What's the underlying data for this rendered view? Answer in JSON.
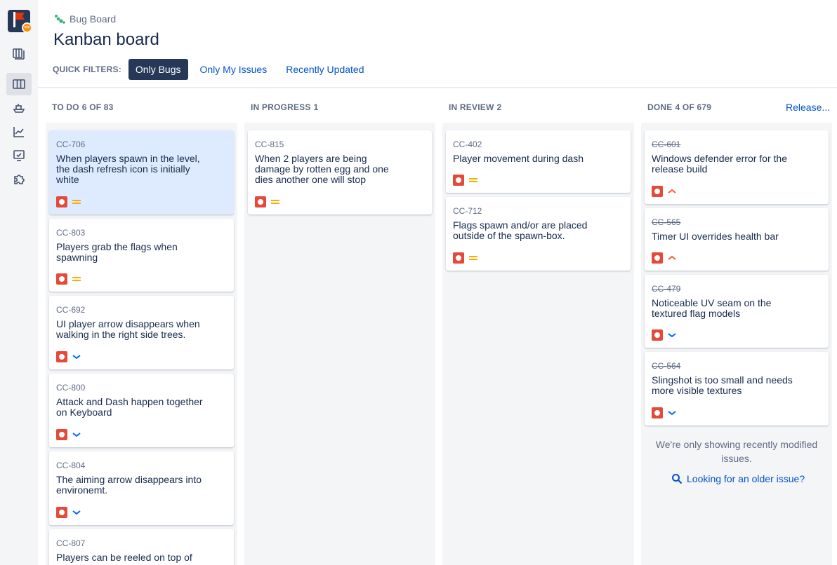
{
  "breadcrumb": {
    "project": "Bug Board"
  },
  "page_title": "Kanban board",
  "quick_filters": {
    "label": "QUICK FILTERS:",
    "items": [
      {
        "label": "Only Bugs",
        "active": true
      },
      {
        "label": "Only My Issues",
        "active": false
      },
      {
        "label": "Recently Updated",
        "active": false
      }
    ]
  },
  "columns": [
    {
      "title": "TO DO",
      "count": "6 OF 83"
    },
    {
      "title": "IN PROGRESS",
      "count": "1"
    },
    {
      "title": "IN REVIEW",
      "count": "2"
    },
    {
      "title": "DONE",
      "count": "4 OF 679",
      "action": "Release..."
    }
  ],
  "cards": {
    "todo": [
      {
        "key": "CC-706",
        "summary": "When players spawn in the level, the dash refresh icon is initially white",
        "priority": "medium",
        "selected": true
      },
      {
        "key": "CC-803",
        "summary": "Players grab the flags when spawning",
        "priority": "medium"
      },
      {
        "key": "CC-692",
        "summary": "UI player arrow disappears when walking in the right side trees.",
        "priority": "low"
      },
      {
        "key": "CC-800",
        "summary": "Attack and Dash happen together on Keyboard",
        "priority": "low"
      },
      {
        "key": "CC-804",
        "summary": "The aiming arrow disappears into environemt.",
        "priority": "low"
      },
      {
        "key": "CC-807",
        "summary": "Players can be reeled on top of"
      }
    ],
    "in_progress": [
      {
        "key": "CC-815",
        "summary": "When 2 players are being damage by rotten egg and one dies another one will stop",
        "priority": "medium"
      }
    ],
    "in_review": [
      {
        "key": "CC-402",
        "summary": "Player movement during dash",
        "priority": "medium"
      },
      {
        "key": "CC-712",
        "summary": "Flags spawn and/or are placed outside of the spawn-box.",
        "priority": "medium"
      }
    ],
    "done": [
      {
        "key": "CC-601",
        "summary": "Windows defender error for the release build",
        "priority": "high"
      },
      {
        "key": "CC-565",
        "summary": "Timer UI overrides health bar",
        "priority": "high"
      },
      {
        "key": "CC-479",
        "summary": "Noticeable UV seam on the textured flag models",
        "priority": "low"
      },
      {
        "key": "CC-564",
        "summary": "Slingshot is too small and needs more visible textures",
        "priority": "low"
      }
    ]
  },
  "done_note": "We're only showing recently modified issues.",
  "older_link": "Looking for an older issue?",
  "colors": {
    "accent": "#0052cc",
    "nav_dark": "#253858",
    "bug_red": "#e5493a",
    "medium": "#ffab00",
    "high": "#ff5630",
    "low": "#0065ff"
  }
}
